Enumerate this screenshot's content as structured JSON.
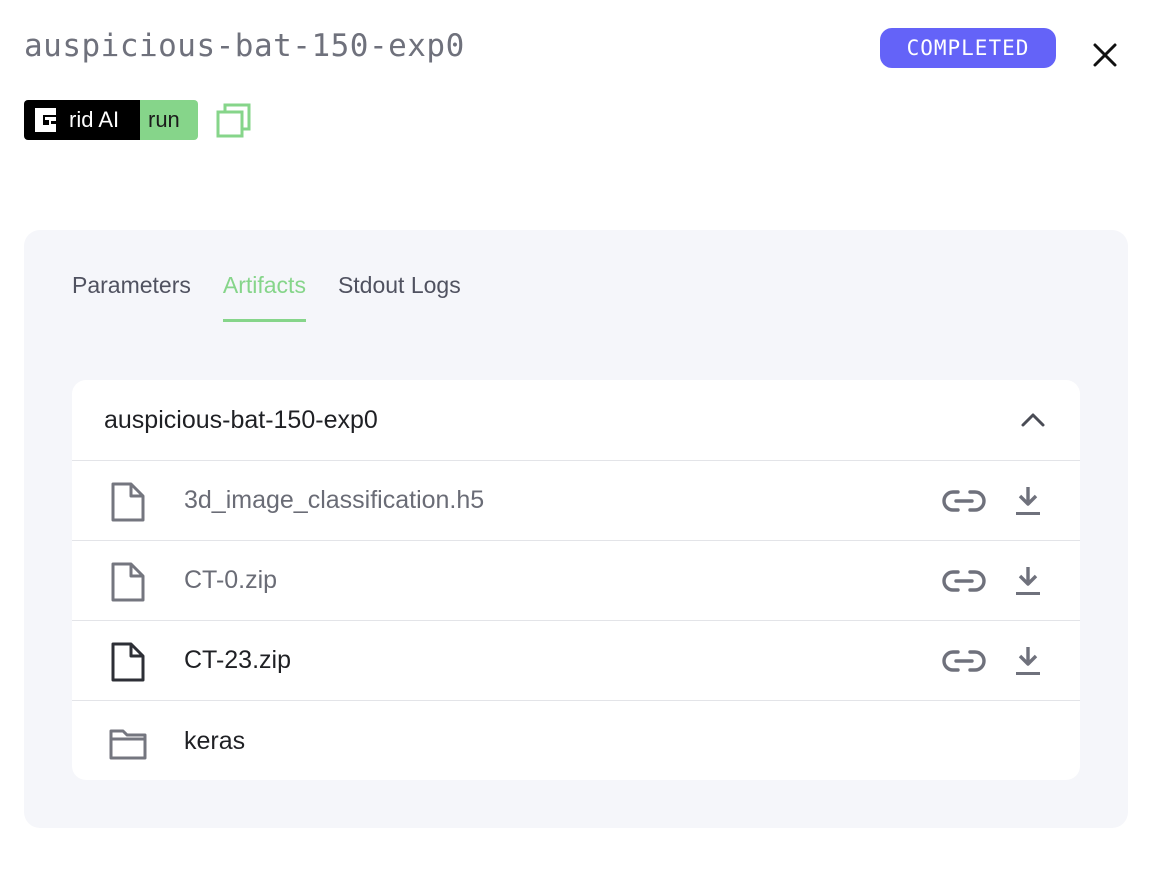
{
  "header": {
    "run_name": "auspicious-bat-150-exp0",
    "status": "COMPLETED",
    "status_color": "#6463f8"
  },
  "badge": {
    "brand": "rid AI",
    "kind": "run",
    "brand_bg": "#000000",
    "kind_bg": "#86d58a"
  },
  "tabs": [
    {
      "label": "Parameters",
      "active": false
    },
    {
      "label": "Artifacts",
      "active": true
    },
    {
      "label": "Stdout Logs",
      "active": false
    }
  ],
  "artifacts": {
    "group_title": "auspicious-bat-150-exp0",
    "items": [
      {
        "name": "3d_image_classification.h5",
        "icon": "file-icon"
      },
      {
        "name": "CT-0.zip",
        "icon": "file-icon"
      },
      {
        "name": "CT-23.zip",
        "icon": "file-icon"
      },
      {
        "name": "keras",
        "icon": "folder-icon"
      }
    ]
  },
  "accent_color": "#86d58a"
}
